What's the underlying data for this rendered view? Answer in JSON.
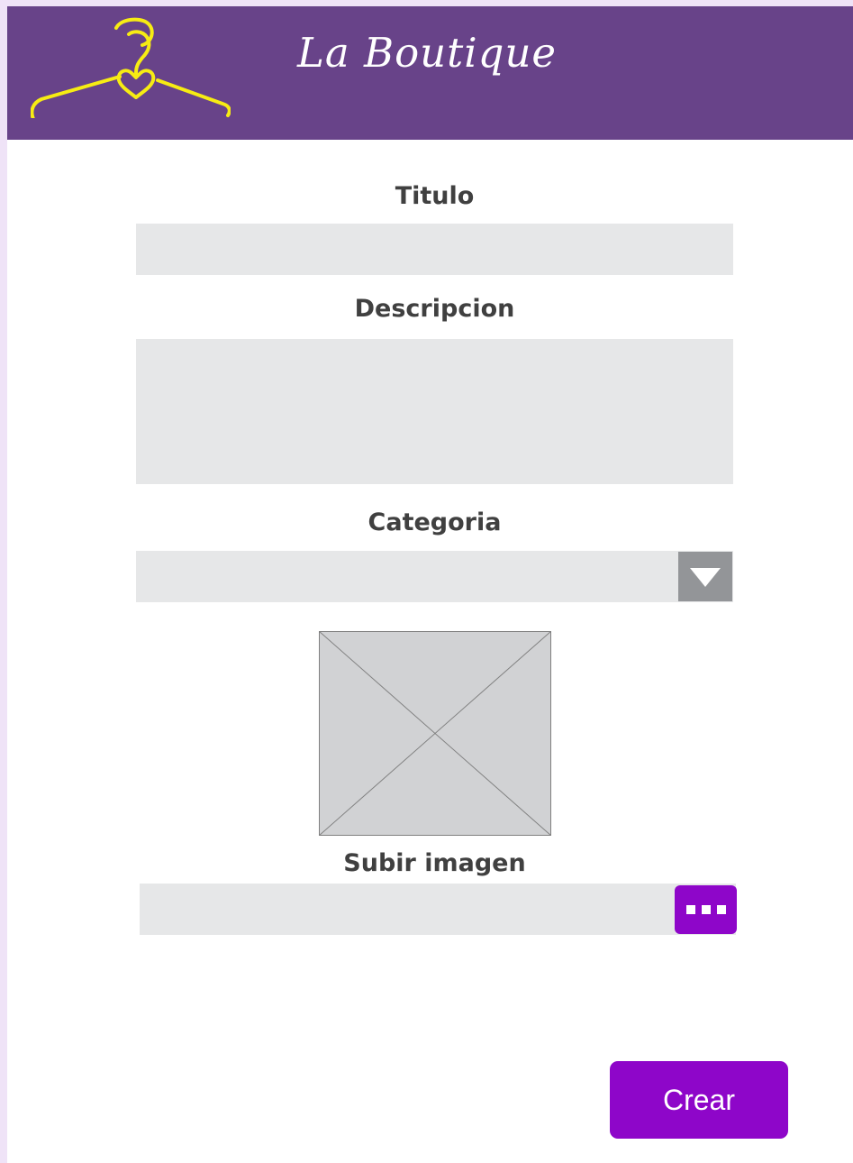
{
  "header": {
    "brand_name": "La Boutique",
    "logo_icon": "hanger-heart-icon",
    "background_color": "#684389",
    "logo_color": "#f7ec13"
  },
  "form": {
    "title_label": "Titulo",
    "title_value": "",
    "description_label": "Descripcion",
    "description_value": "",
    "category_label": "Categoria",
    "category_selected": "",
    "category_arrow_icon": "triangle-down-icon",
    "image_placeholder_icon": "image-placeholder-icon",
    "upload_label": "Subir imagen",
    "upload_value": "",
    "browse_icon": "ellipsis-icon"
  },
  "actions": {
    "create_label": "Crear"
  },
  "colors": {
    "accent": "#8e06c9",
    "field_background": "#e6e7e8",
    "label_text": "#404040",
    "page_border": "#efe3f7"
  }
}
